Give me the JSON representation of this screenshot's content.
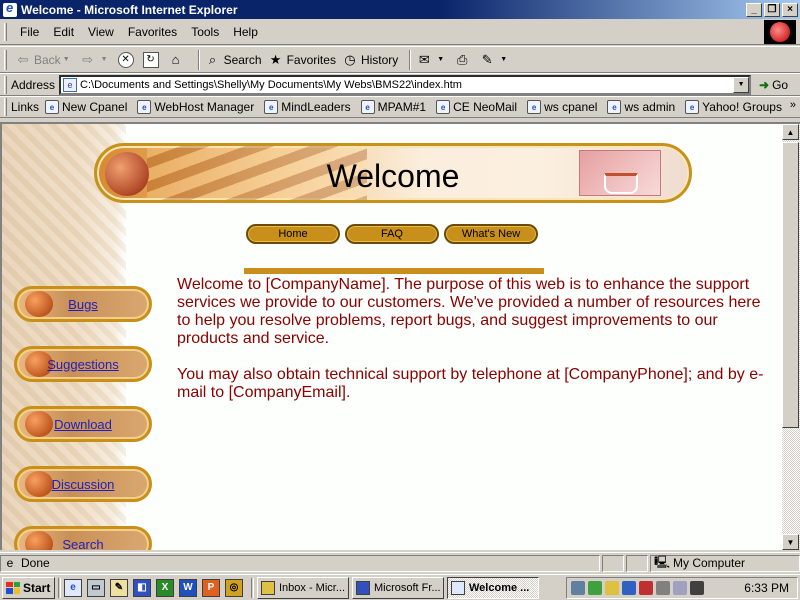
{
  "window": {
    "title": "Welcome - Microsoft Internet Explorer",
    "minimize": "_",
    "maximize": "❐",
    "close": "×"
  },
  "menu": [
    "File",
    "Edit",
    "View",
    "Favorites",
    "Tools",
    "Help"
  ],
  "toolbar": {
    "back": "Back",
    "forward": "",
    "search": "Search",
    "favorites": "Favorites",
    "history": "History"
  },
  "address": {
    "label": "Address",
    "value": "C:\\Documents and Settings\\Shelly\\My Documents\\My Webs\\BMS22\\index.htm",
    "go": "Go"
  },
  "links": {
    "label": "Links",
    "items": [
      "New Cpanel",
      "WebHost Manager",
      "MindLeaders",
      "MPAM#1",
      "CE NeoMail",
      "ws cpanel",
      "ws admin",
      "Yahoo! Groups"
    ],
    "more": "»"
  },
  "page": {
    "banner_title": "Welcome",
    "nav": [
      "Home",
      "FAQ",
      "What's New"
    ],
    "sidebar": [
      "Bugs",
      "Suggestions",
      "Download",
      "Discussion",
      "Search"
    ],
    "paragraphs": [
      "Welcome to [CompanyName]. The purpose of this web is to enhance the support services we provide to our customers. We've provided a number of resources here to help you resolve problems, report bugs, and suggest improvements to our products and service.",
      "You may also obtain technical support by telephone at [CompanyPhone]; and by e-mail to [CompanyEmail]."
    ]
  },
  "status": {
    "text": "Done",
    "zone": "My Computer"
  },
  "taskbar": {
    "start": "Start",
    "tasks": [
      "Inbox - Micr...",
      "Microsoft Fr...",
      "Welcome ..."
    ],
    "clock": "6:33 PM"
  }
}
